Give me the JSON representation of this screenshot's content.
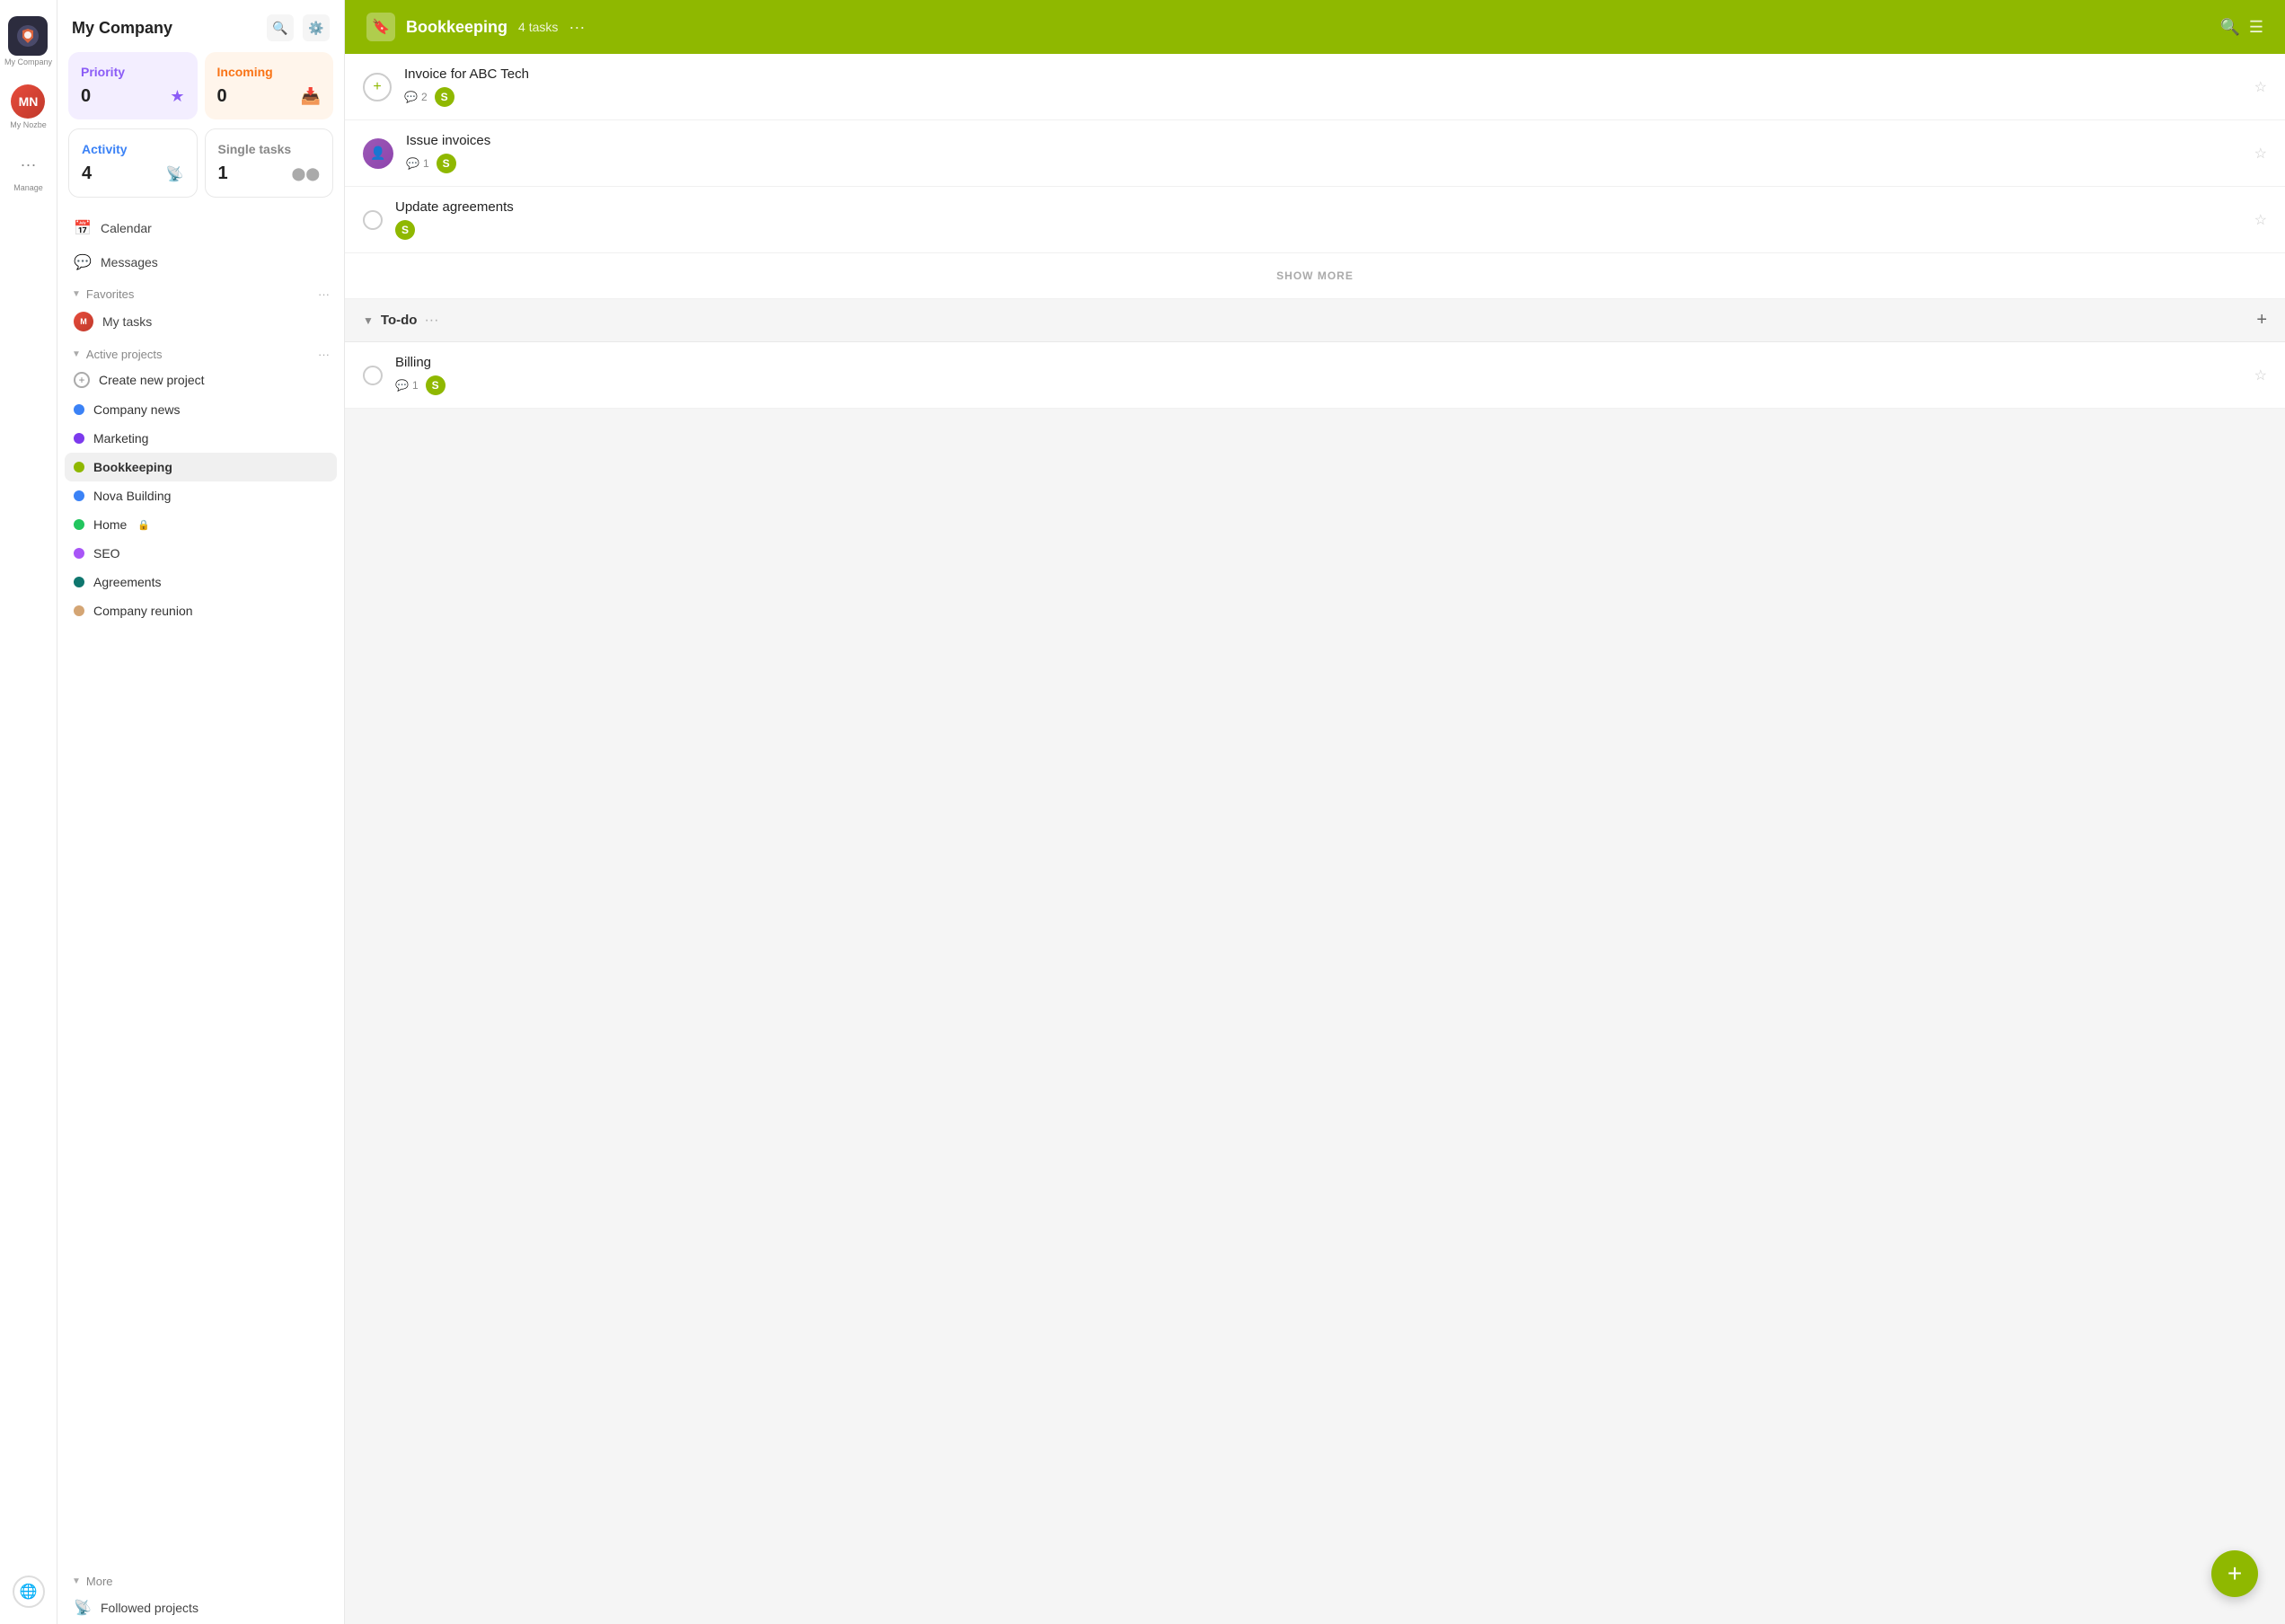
{
  "app": {
    "company_name": "My Company",
    "logo_letters": "N"
  },
  "icon_bar": {
    "my_nozbe_label": "My Nozbe",
    "manage_label": "Manage"
  },
  "sidebar": {
    "title": "My Company",
    "stats": {
      "priority": {
        "label": "Priority",
        "count": "0",
        "icon": "★"
      },
      "incoming": {
        "label": "Incoming",
        "count": "0",
        "icon": "📥"
      },
      "activity": {
        "label": "Activity",
        "count": "4",
        "icon": "📡"
      },
      "single_tasks": {
        "label": "Single tasks",
        "count": "1",
        "icon": "⬤⬤"
      }
    },
    "nav_items": [
      {
        "icon": "📅",
        "label": "Calendar"
      },
      {
        "icon": "💬",
        "label": "Messages"
      }
    ],
    "favorites": {
      "section_label": "Favorites",
      "items": [
        {
          "label": "My tasks",
          "has_avatar": true
        }
      ]
    },
    "active_projects": {
      "section_label": "Active projects",
      "items": [
        {
          "label": "Create new project",
          "type": "add",
          "color": ""
        },
        {
          "label": "Company news",
          "type": "dot",
          "color": "#3b82f6"
        },
        {
          "label": "Marketing",
          "type": "dot",
          "color": "#7c3aed"
        },
        {
          "label": "Bookkeeping",
          "type": "dot",
          "color": "#8fb800",
          "active": true
        },
        {
          "label": "Nova Building",
          "type": "dot",
          "color": "#3b82f6"
        },
        {
          "label": "Home",
          "type": "dot",
          "color": "#22c55e",
          "has_lock": true
        },
        {
          "label": "SEO",
          "type": "dot",
          "color": "#a855f7"
        },
        {
          "label": "Agreements",
          "type": "dot",
          "color": "#0f766e"
        },
        {
          "label": "Company reunion",
          "type": "dot",
          "color": "#d4a574"
        }
      ]
    },
    "more": {
      "section_label": "More",
      "items": [
        {
          "icon": "📡",
          "label": "Followed projects"
        }
      ]
    }
  },
  "main": {
    "header": {
      "project_icon": "🔖",
      "project_name": "Bookkeeping",
      "tasks_count": "4 tasks",
      "dots_label": "···",
      "search_label": "🔍"
    },
    "sections": [
      {
        "name": "incoming_tasks",
        "tasks": [
          {
            "title": "Invoice for ABC Tech",
            "comments": "2",
            "assignee_color": "#8fb800",
            "assignee_letter": "S"
          },
          {
            "title": "Issue invoices",
            "comments": "1",
            "has_avatar": true,
            "assignee_color": "#8fb800",
            "assignee_letter": "S"
          },
          {
            "title": "Update agreements",
            "comments": "",
            "assignee_color": "#8fb800",
            "assignee_letter": "S"
          }
        ],
        "show_more_label": "SHOW MORE"
      },
      {
        "name": "To-do",
        "tasks": [
          {
            "title": "Billing",
            "comments": "1",
            "assignee_color": "#8fb800",
            "assignee_letter": "S"
          }
        ]
      }
    ]
  },
  "colors": {
    "header_bg": "#8fb800",
    "priority_bg": "#f3eeff",
    "priority_text": "#8b5cf6",
    "incoming_bg": "#fff5eb",
    "incoming_text": "#f97316"
  }
}
